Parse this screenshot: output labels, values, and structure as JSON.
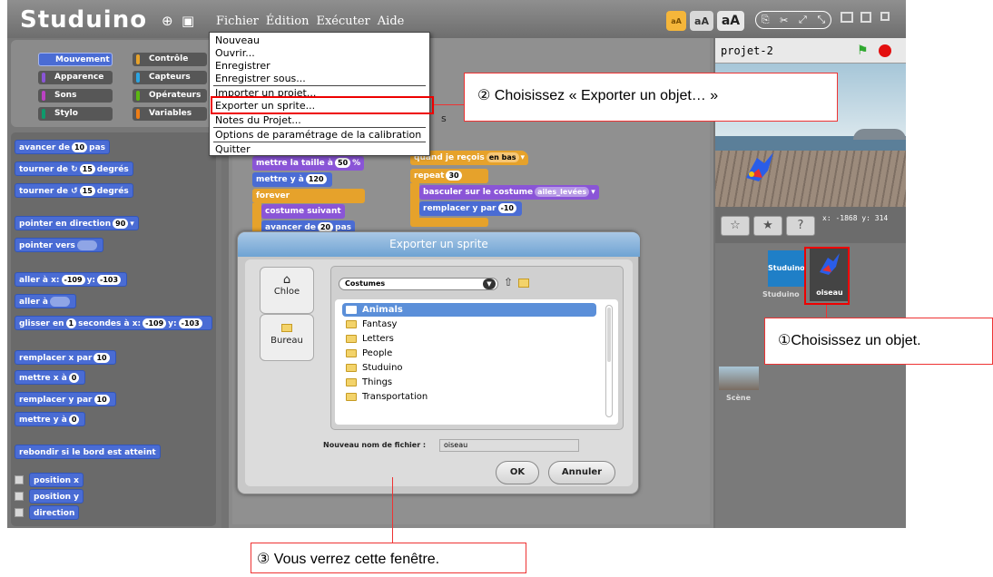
{
  "app": {
    "logo": "Studuino",
    "menus": [
      "Fichier",
      "Édition",
      "Exécuter",
      "Aide"
    ],
    "size_buttons": [
      "aA",
      "aA",
      "aA"
    ]
  },
  "categories": [
    {
      "label": "Mouvement",
      "color": "#4a6cd4"
    },
    {
      "label": "Contrôle",
      "color": "#e6a22b"
    },
    {
      "label": "Apparence",
      "color": "#8a55d7"
    },
    {
      "label": "Capteurs",
      "color": "#2ca5e2"
    },
    {
      "label": "Sons",
      "color": "#bb42c3"
    },
    {
      "label": "Opérateurs",
      "color": "#5cb712"
    },
    {
      "label": "Stylo",
      "color": "#0e9a6c"
    },
    {
      "label": "Variables",
      "color": "#ee7d16"
    }
  ],
  "palette_blocks": {
    "b1": "avancer de",
    "b1v": "10",
    "b1s": "pas",
    "b2": "tourner de",
    "b2v": "15",
    "b2s": "degrés",
    "b3": "tourner de",
    "b3v": "15",
    "b3s": "degrés",
    "b4": "pointer en direction",
    "b4v": "90",
    "b5": "pointer vers",
    "b6": "aller à x:",
    "b6x": "-109",
    "b6y0": "y:",
    "b6y": "-103",
    "b7": "aller à",
    "b8": "glisser en",
    "b8v": "1",
    "b8s": "secondes à x:",
    "b8x": "-109",
    "b8y0": "y:",
    "b8y": "-103",
    "b9": "remplacer x par",
    "b9v": "10",
    "b10": "mettre x à",
    "b10v": "0",
    "b11": "remplacer y par",
    "b11v": "10",
    "b12": "mettre y à",
    "b12v": "0",
    "b13": "rebondir si le bord est atteint",
    "c1": "position x",
    "c2": "position y",
    "c3": "direction"
  },
  "script_blocks": {
    "s1": "mettre la taille à",
    "s1v": "50",
    "s1s": "%",
    "s2": "mettre y à",
    "s2v": "120",
    "s3": "forever",
    "s4": "costume suivant",
    "s5": "avancer de",
    "s5v": "20",
    "s5s": "pas",
    "t1": "quand je reçois",
    "t1v": "en bas",
    "t2": "repeat",
    "t2v": "30",
    "t3": "basculer sur le costume",
    "t3v": "ailes_levées",
    "t4": "remplacer y par",
    "t4v": "-10",
    "partial": "s"
  },
  "stage": {
    "name": "projet-2",
    "coords": "x: -1868  y: 314"
  },
  "sprites": {
    "s1": "Studuino",
    "s1b": "Studuino",
    "s2": "oiseau",
    "scene": "Scène"
  },
  "file_menu": [
    "Nouveau",
    "Ouvrir...",
    "Enregistrer",
    "Enregistrer sous...",
    "Importer un projet...",
    "Exporter un sprite...",
    "Notes du Projet...",
    "Options de paramétrage de la calibration",
    "Quitter"
  ],
  "dialog": {
    "title": "Exporter un sprite",
    "side": [
      "Chloe",
      "Bureau"
    ],
    "folder": "Costumes",
    "files": [
      "Animals",
      "Fantasy",
      "Letters",
      "People",
      "Studuino",
      "Things",
      "Transportation"
    ],
    "filename_label": "Nouveau nom de fichier :",
    "filename": "oiseau",
    "ok": "OK",
    "cancel": "Annuler"
  },
  "callouts": {
    "c1": "①Choisissez un objet.",
    "c2": "② Choisissez « Exporter un objet… »",
    "c3": "③ Vous verrez cette fenêtre."
  }
}
